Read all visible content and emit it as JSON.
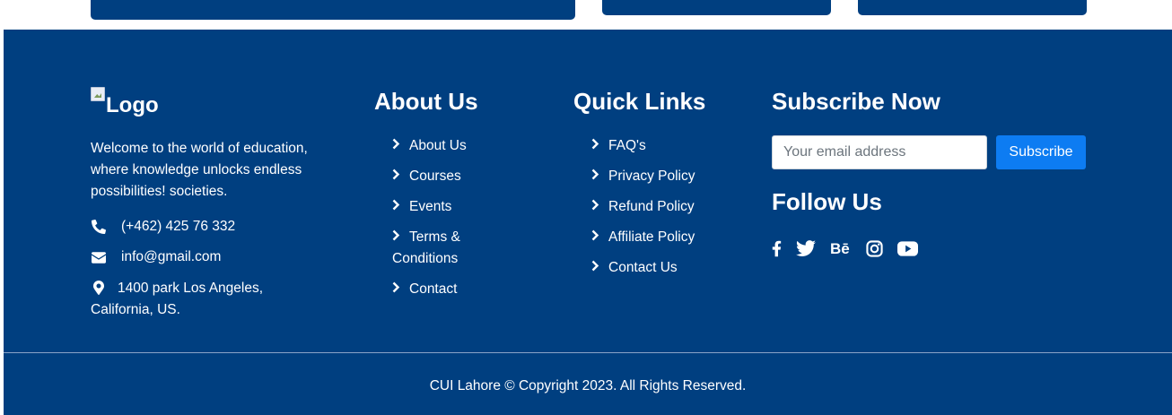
{
  "brand": {
    "logo_alt": "Logo"
  },
  "about": {
    "description": "Welcome to the world of education, where knowledge unlocks endless possibilities! societies.",
    "phone": "(+462) 425 76 332",
    "email": "info@gmail.com",
    "address": "1400 park Los Angeles, California, US."
  },
  "about_us": {
    "title": "About Us",
    "links": [
      "About Us",
      "Courses",
      "Events",
      "Terms & Conditions",
      "Contact"
    ]
  },
  "quick_links": {
    "title": "Quick Links",
    "links": [
      "FAQ's",
      "Privacy Policy",
      "Refund Policy",
      "Affiliate Policy",
      "Contact Us"
    ]
  },
  "subscribe": {
    "title": "Subscribe Now",
    "placeholder": "Your email address",
    "button_label": "Subscribe"
  },
  "follow": {
    "title": "Follow Us",
    "icons": [
      "facebook-icon",
      "twitter-icon",
      "behance-icon",
      "instagram-icon",
      "youtube-icon"
    ]
  },
  "copyright": "CUI Lahore © Copyright 2023. All Rights Reserved.",
  "colors": {
    "footer_bg": "#003f80",
    "button_bg": "#0d7cf2",
    "text": "#ffffff"
  }
}
